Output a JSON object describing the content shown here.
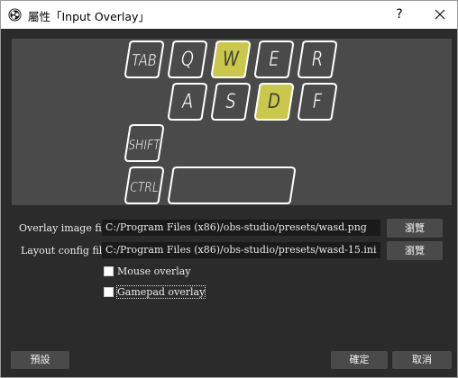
{
  "window": {
    "title": "屬性「Input Overlay」",
    "help_label": "?",
    "app_icon": "obs-logo-icon",
    "close_icon": "close-icon"
  },
  "preview": {
    "keys": [
      {
        "label": "TAB",
        "pressed": false
      },
      {
        "label": "Q",
        "pressed": false
      },
      {
        "label": "W",
        "pressed": true
      },
      {
        "label": "E",
        "pressed": false
      },
      {
        "label": "R",
        "pressed": false
      },
      {
        "label": "A",
        "pressed": false
      },
      {
        "label": "S",
        "pressed": false
      },
      {
        "label": "D",
        "pressed": true
      },
      {
        "label": "F",
        "pressed": false
      },
      {
        "label": "SHIFT",
        "pressed": false
      },
      {
        "label": "CTRL",
        "pressed": false
      },
      {
        "label": "",
        "pressed": false
      }
    ],
    "colors": {
      "background": "#4a4a4a",
      "key_fill": "#4a4a4a",
      "key_pressed_fill": "#c9c84a",
      "key_outline": "#ffffff"
    }
  },
  "form": {
    "image_file": {
      "label": "Overlay image file",
      "value": "C:/Program Files (x86)/obs-studio/presets/wasd.png",
      "browse_label": "瀏覽"
    },
    "config_file": {
      "label": "Layout config file",
      "value": "C:/Program Files (x86)/obs-studio/presets/wasd-15.ini",
      "browse_label": "瀏覽"
    },
    "mouse_overlay": {
      "label": "Mouse overlay",
      "checked": false
    },
    "gamepad_overlay": {
      "label": "Gamepad overlay",
      "checked": false
    }
  },
  "footer": {
    "defaults_label": "預設",
    "ok_label": "確定",
    "cancel_label": "取消"
  }
}
